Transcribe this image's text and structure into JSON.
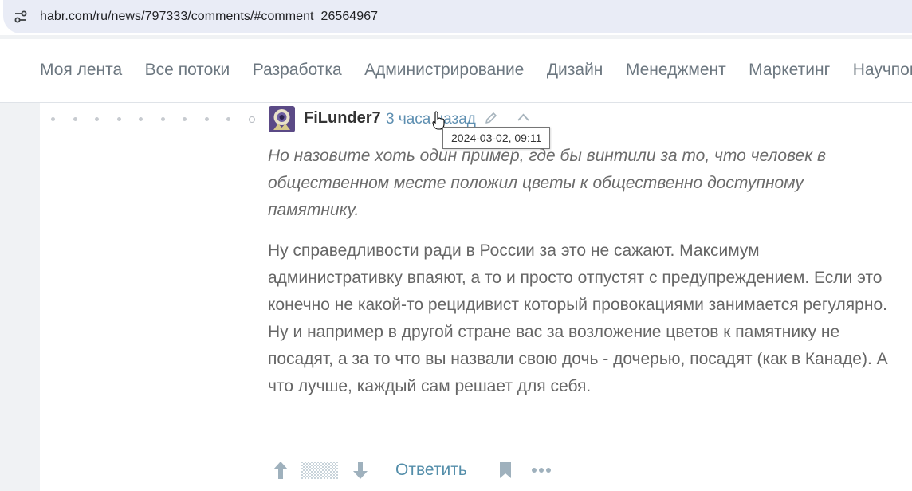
{
  "browser": {
    "url": "habr.com/ru/news/797333/comments/#comment_26564967"
  },
  "nav": {
    "items": [
      {
        "label": "Моя лента"
      },
      {
        "label": "Все потоки"
      },
      {
        "label": "Разработка"
      },
      {
        "label": "Администрирование"
      },
      {
        "label": "Дизайн"
      },
      {
        "label": "Менеджмент"
      },
      {
        "label": "Маркетинг"
      },
      {
        "label": "Научпоп"
      }
    ]
  },
  "comment": {
    "author": "FiLunder7",
    "time_ago": "3 часа назад",
    "tooltip_datetime": "2024-03-02, 09:11",
    "quote": "Но назовите хоть один пример, где бы винтили за то, что человек в общественном месте положил цветы к общественно доступному памятнику.",
    "body": "Ну справедливости ради в России за это не сажают. Максимум административку впаяют, а то и просто отпустят с предупреждением. Если это конечно не какой-то рецидивист который провокациями занимается регулярно. Ну и например в другой стране вас за возложение цветов к памятнику не посадят, а за то что вы назвали свою дочь - дочерью, посадят (как в Канаде). А что лучше, каждый сам решает для себя.",
    "reply_label": "Ответить"
  },
  "icons": {
    "site_settings": "site-settings-icon",
    "edit": "pencil-icon",
    "to_parent": "chevron-up-icon",
    "vote_up": "arrow-up-icon",
    "vote_down": "arrow-down-icon",
    "bookmark": "bookmark-icon",
    "more": "more-dots-icon"
  },
  "colors": {
    "link": "#548eaa",
    "nav_text": "#6c7780",
    "page_bg": "#f0f2f4"
  }
}
